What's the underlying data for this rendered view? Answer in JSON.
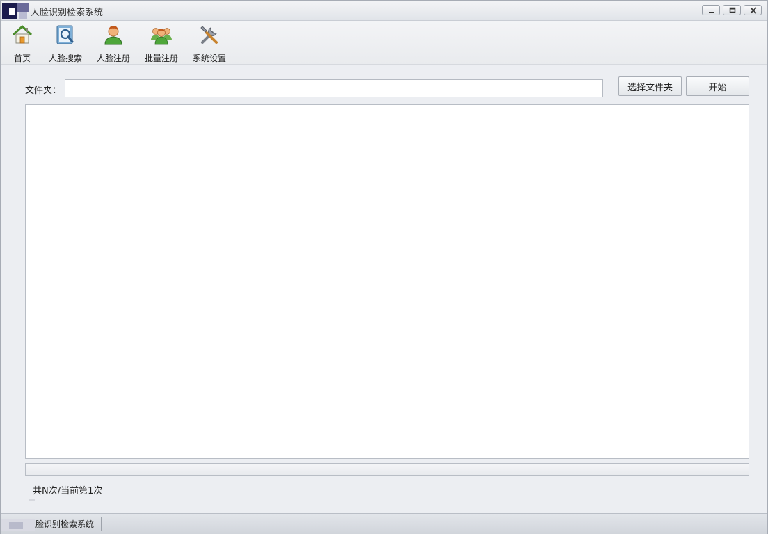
{
  "window": {
    "title": "人脸识别检索系统",
    "minimize_icon": "minimize-icon",
    "maximize_icon": "maximize-icon",
    "close_icon": "close-icon"
  },
  "toolbar": {
    "items": [
      {
        "label": "首页",
        "icon": "home-icon"
      },
      {
        "label": "人脸搜索",
        "icon": "face-search-icon"
      },
      {
        "label": "人脸注册",
        "icon": "face-register-icon"
      },
      {
        "label": "批量注册",
        "icon": "batch-register-icon"
      },
      {
        "label": "系统设置",
        "icon": "settings-tools-icon"
      }
    ]
  },
  "form": {
    "folder_label": "文件夹：",
    "folder_value": "",
    "select_folder_button": "选择文件夹",
    "start_button": "开始"
  },
  "progress": {
    "value": 0
  },
  "status": {
    "count_text": "共N次/当前第1次",
    "statusbar_text": "脸识别检索系统"
  }
}
